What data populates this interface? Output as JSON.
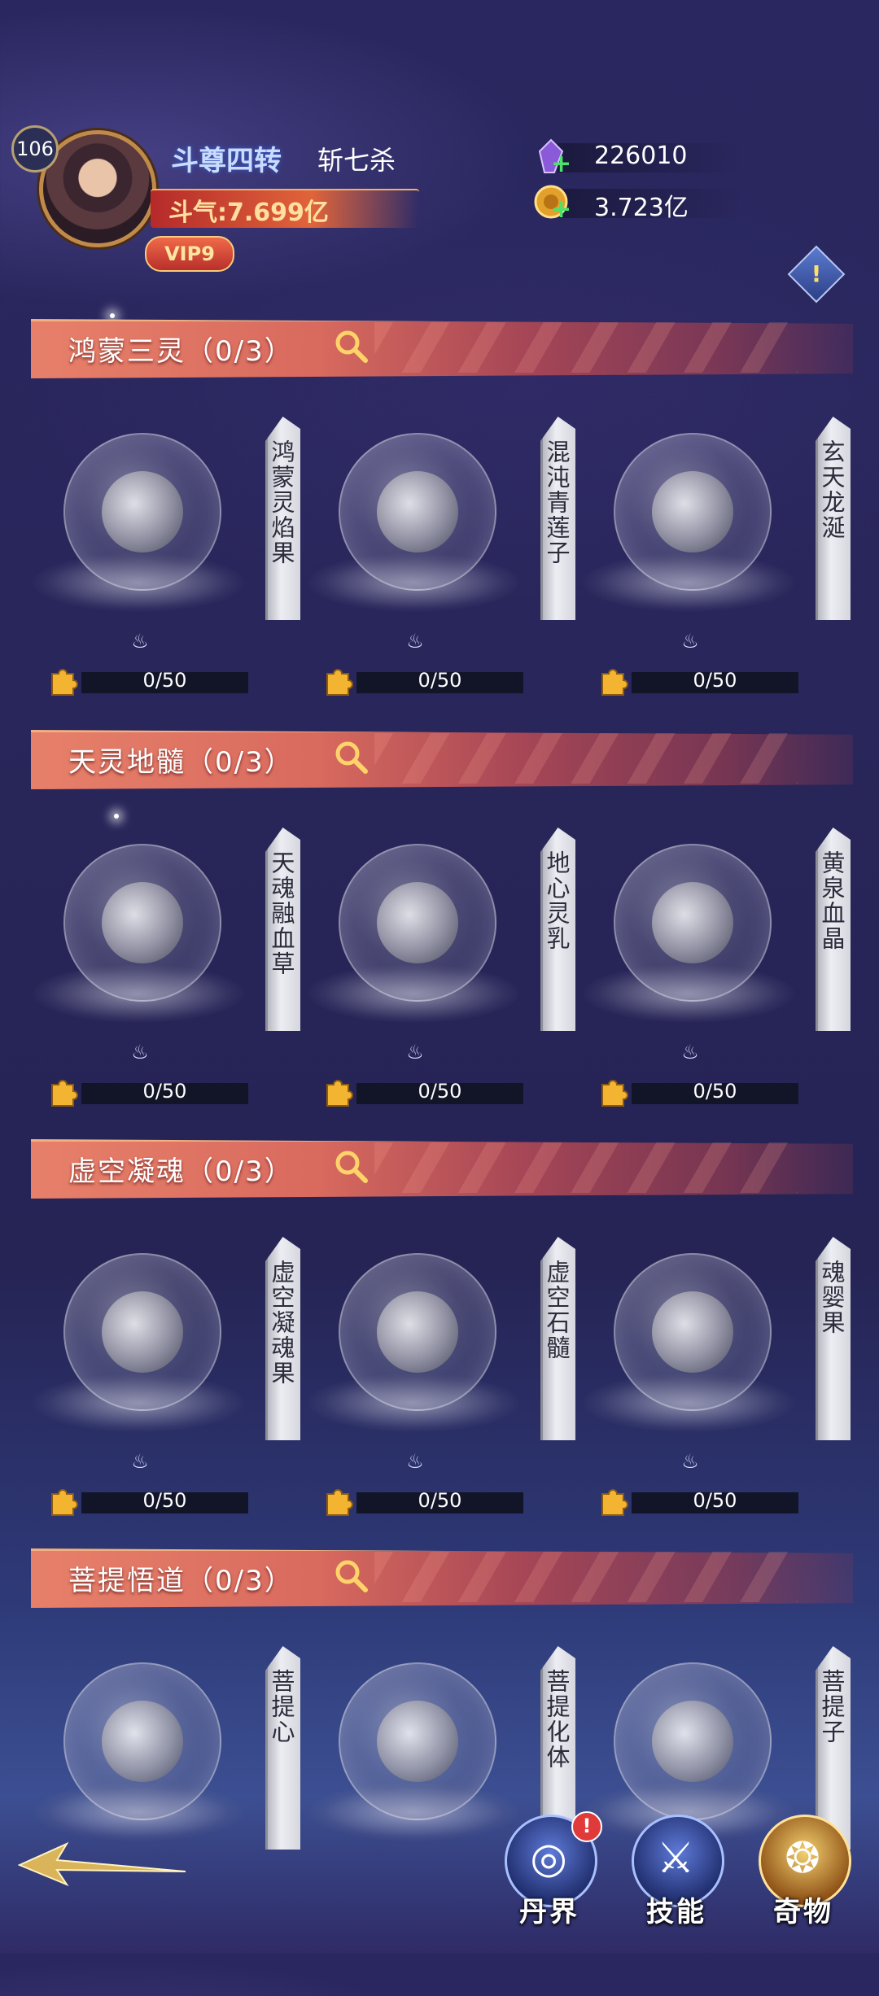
{
  "header": {
    "level": "106",
    "rank_title": "斗尊四转",
    "player_name": "斩七杀",
    "power": "斗气:7.699亿",
    "vip": "VIP9",
    "resources": [
      {
        "icon": "purple-crystal-icon",
        "value": "226010"
      },
      {
        "icon": "gold-coin-icon",
        "value": "3.723亿"
      }
    ],
    "info_label": "!"
  },
  "sections": [
    {
      "title": "鸿蒙三灵（0/3）",
      "items": [
        {
          "name": "鸿蒙灵焰果",
          "progress": "0/50",
          "fraction": 0
        },
        {
          "name": "混沌青莲子",
          "progress": "0/50",
          "fraction": 0
        },
        {
          "name": "玄天龙涎",
          "progress": "0/50",
          "fraction": 0
        }
      ]
    },
    {
      "title": "天灵地髓（0/3）",
      "items": [
        {
          "name": "天魂融血草",
          "progress": "0/50",
          "fraction": 0
        },
        {
          "name": "地心灵乳",
          "progress": "0/50",
          "fraction": 0
        },
        {
          "name": "黄泉血晶",
          "progress": "0/50",
          "fraction": 0
        }
      ]
    },
    {
      "title": "虚空凝魂（0/3）",
      "items": [
        {
          "name": "虚空凝魂果",
          "progress": "0/50",
          "fraction": 0
        },
        {
          "name": "虚空石髓",
          "progress": "0/50",
          "fraction": 0
        },
        {
          "name": "魂婴果",
          "progress": "0/50",
          "fraction": 0
        }
      ]
    },
    {
      "title": "菩提悟道（0/3）",
      "items": [
        {
          "name": "菩提心"
        },
        {
          "name": "菩提化体"
        },
        {
          "name": "菩提子"
        }
      ]
    }
  ],
  "nav": [
    {
      "label": "丹界",
      "icon": "dan-realm-icon",
      "badge": "!"
    },
    {
      "label": "技能",
      "icon": "skill-sword-icon"
    },
    {
      "label": "奇物",
      "icon": "treasure-icon",
      "active": true
    }
  ]
}
